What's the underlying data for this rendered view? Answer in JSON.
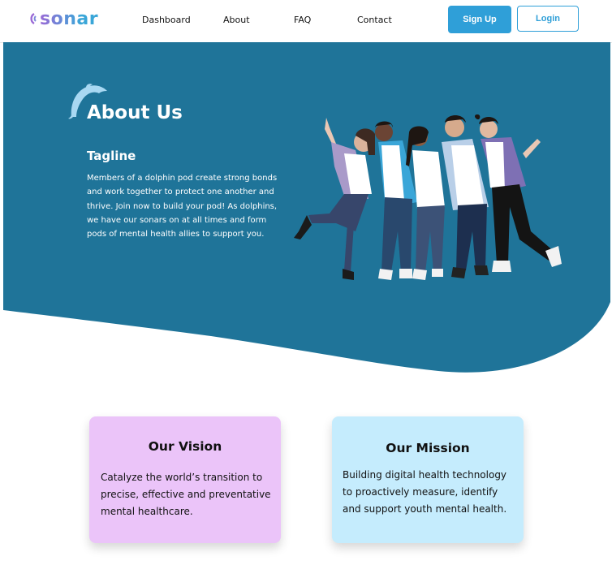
{
  "nav": {
    "logo_text": "sonar",
    "links": [
      "Dashboard",
      "About",
      "FAQ",
      "Contact"
    ],
    "signup_label": "Sign Up",
    "login_label": "Login"
  },
  "hero": {
    "title": "About Us",
    "tagline": "Tagline",
    "description": "Members of a dolphin pod create strong bonds and work together to protect one another and thrive. Join now to build your pod! As dolphins, we have our sonars on at all times and form pods of mental health allies to support you.",
    "illustration": "group-of-friends-illustration",
    "colors": {
      "background": "#1f7499",
      "accent": "#2f9fd8"
    }
  },
  "cards": {
    "vision": {
      "title": "Our Vision",
      "text": "Catalyze the world’s transition to precise, effective and preventative mental healthcare.",
      "color": "#ebc4f9"
    },
    "mission": {
      "title": "Our Mission",
      "text": "Building digital health technology to proactively measure, identify and support youth mental health.",
      "color": "#c5ecfd"
    }
  }
}
